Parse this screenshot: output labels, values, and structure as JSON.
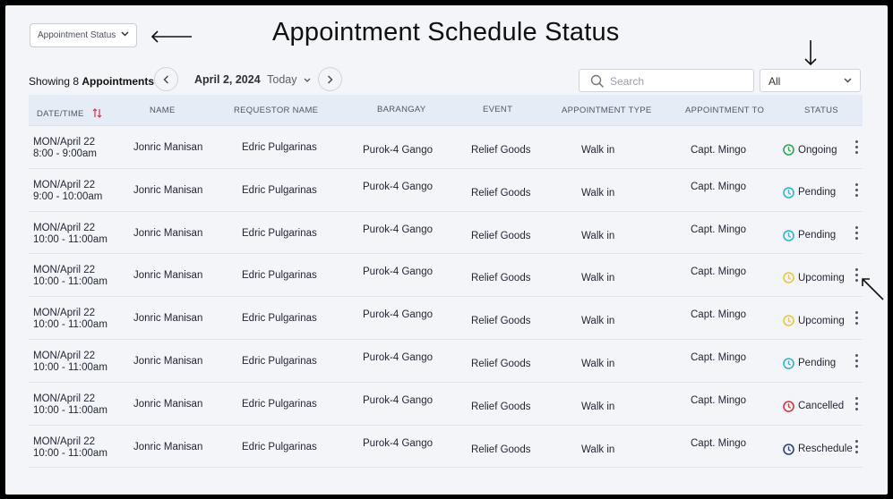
{
  "header": {
    "dropdown_label": "Appointment Status",
    "title": "Appointment Schedule Status"
  },
  "toolbar": {
    "showing_prefix": "Showing 8",
    "showing_suffix": "Appointments",
    "date": "April 2, 2024",
    "today": "Today",
    "search_placeholder": "Search",
    "filter_value": "All"
  },
  "table": {
    "headers": {
      "datetime": "DATE/TIME",
      "name": "NAME",
      "requestor": "REQUESTOR NAME",
      "barangay": "BARANGAY",
      "event": "EVENT",
      "type": "APPOINTMENT TYPE",
      "to": "APPOINTMENT TO",
      "status": "STATUS"
    },
    "rows": [
      {
        "day": "MON/April 22",
        "time": "8:00 - 9:00am",
        "name": "Jonric Manisan",
        "requestor": "Edric Pulgarinas",
        "barangay": "Purok-4 Gango",
        "event": "Relief Goods",
        "type": "Walk in",
        "to": "Capt. Mingo",
        "status": "Ongoing",
        "status_color": "#2fa84f"
      },
      {
        "day": "MON/April 22",
        "time": "9:00 - 10:00am",
        "name": "Jonric Manisan",
        "requestor": "Edric Pulgarinas",
        "barangay": "Purok-4 Gango",
        "event": "Relief Goods",
        "type": "Walk in",
        "to": "Capt. Mingo",
        "status": "Pending",
        "status_color": "#27b6d8"
      },
      {
        "day": "MON/April 22",
        "time": "10:00 - 11:00am",
        "name": "Jonric Manisan",
        "requestor": "Edric Pulgarinas",
        "barangay": "Purok-4 Gango",
        "event": "Relief Goods",
        "type": "Walk in",
        "to": "Capt. Mingo",
        "status": "Pending",
        "status_color": "#27b6d8"
      },
      {
        "day": "MON/April 22",
        "time": "10:00 - 11:00am",
        "name": "Jonric Manisan",
        "requestor": "Edric Pulgarinas",
        "barangay": "Purok-4 Gango",
        "event": "Relief Goods",
        "type": "Walk in",
        "to": "Capt. Mingo",
        "status": "Upcoming",
        "status_color": "#e9c838"
      },
      {
        "day": "MON/April 22",
        "time": "10:00 - 11:00am",
        "name": "Jonric Manisan",
        "requestor": "Edric Pulgarinas",
        "barangay": "Purok-4 Gango",
        "event": "Relief Goods",
        "type": "Walk in",
        "to": "Capt. Mingo",
        "status": "Upcoming",
        "status_color": "#e9c838"
      },
      {
        "day": "MON/April 22",
        "time": "10:00 - 11:00am",
        "name": "Jonric Manisan",
        "requestor": "Edric Pulgarinas",
        "barangay": "Purok-4 Gango",
        "event": "Relief Goods",
        "type": "Walk in",
        "to": "Capt. Mingo",
        "status": "Pending",
        "status_color": "#27b6d8"
      },
      {
        "day": "MON/April 22",
        "time": "10:00 - 11:00am",
        "name": "Jonric Manisan",
        "requestor": "Edric Pulgarinas",
        "barangay": "Purok-4 Gango",
        "event": "Relief Goods",
        "type": "Walk in",
        "to": "Capt. Mingo",
        "status": "Cancelled",
        "status_color": "#e0323a"
      },
      {
        "day": "MON/April 22",
        "time": "10:00 - 11:00am",
        "name": "Jonric Manisan",
        "requestor": "Edric Pulgarinas",
        "barangay": "Purok-4 Gango",
        "event": "Relief Goods",
        "type": "Walk in",
        "to": "Capt. Mingo",
        "status": "Reschedule",
        "status_color": "#2c3f86"
      }
    ]
  },
  "icons": {
    "sort": "sort-arrows-icon",
    "prev": "chevron-left-icon",
    "next": "chevron-right-icon",
    "search": "search-icon",
    "status": "clock-icon",
    "menu": "kebab-menu-icon"
  }
}
